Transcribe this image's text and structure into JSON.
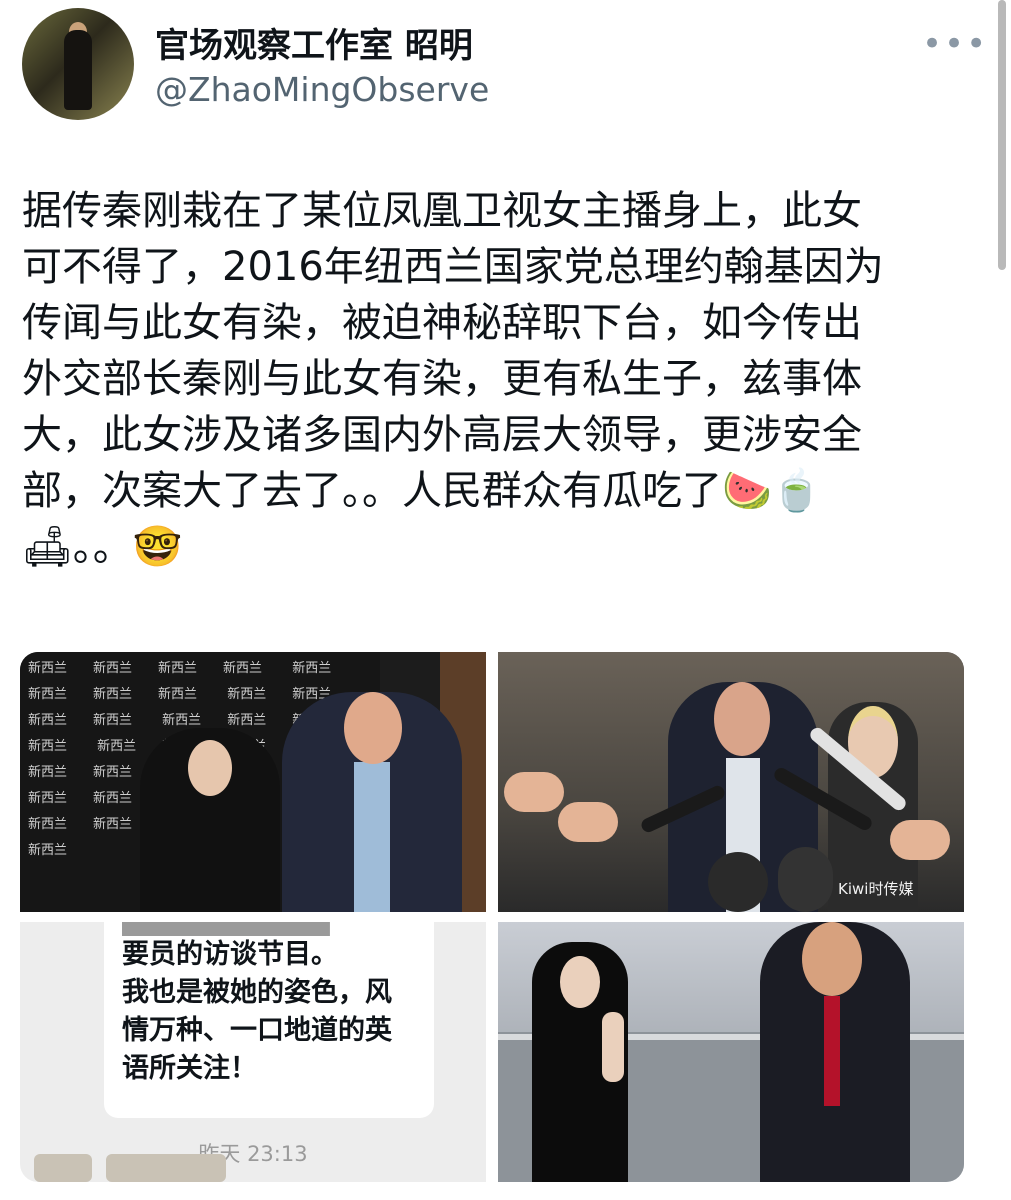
{
  "author": {
    "display_name": "官场观察工作室 昭明",
    "handle": "@ZhaoMingObserve",
    "more_label": "•••"
  },
  "tweet": {
    "lines": [
      "据传秦刚栽在了某位凤凰卫视女主播身上，此女",
      "可不得了，2016年纽西兰国家党总理约翰基因为",
      "传闻与此女有染，被迫神秘辞职下台，如今传出",
      "外交部长秦刚与此女有染，更有私生子，兹事体",
      "大，此女涉及诸多国内外高层大领导，更涉安全",
      "部，次案大了去了。。人民群众有瓜吃了🍉🍵",
      "🛋。。🤓"
    ]
  },
  "media": {
    "photo1": {
      "backdrop_label": "新西兰"
    },
    "photo2": {
      "watermark": "Kiwi时传媒"
    },
    "photo3": {
      "chat_lines": [
        "要员的访谈节目。",
        "我也是被她的姿色，风",
        "情万种、一口地道的英",
        "语所关注！"
      ],
      "timestamp": "昨天 23:13"
    }
  }
}
